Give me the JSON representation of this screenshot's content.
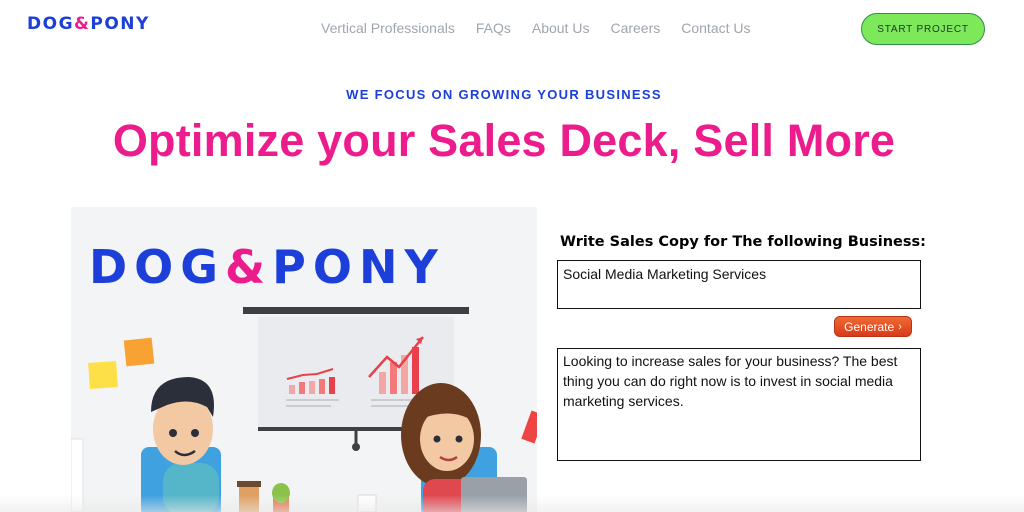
{
  "header": {
    "logo_left": "DOG",
    "logo_amp": "&",
    "logo_right": "PONY",
    "nav": [
      "Vertical Professionals",
      "FAQs",
      "About Us",
      "Careers",
      "Contact Us"
    ],
    "cta_label": "START PROJECT"
  },
  "hero": {
    "eyebrow": "WE FOCUS ON GROWING YOUR BUSINESS",
    "headline": "Optimize your Sales Deck, Sell More"
  },
  "illustration": {
    "logo_left": "DOG",
    "logo_amp": "&",
    "logo_right": "PONY"
  },
  "form": {
    "heading": "Write Sales Copy for The following Business:",
    "business_value": "Social Media Marketing Services",
    "generate_label": "Generate",
    "generate_icon": "chevron-right-icon",
    "output_text": "Looking to increase sales for your business? The best thing you can do right now is to invest in social media marketing services."
  },
  "colors": {
    "brand_blue": "#1b3fd8",
    "brand_pink": "#ec1c8c",
    "cta_green": "#7ce85a",
    "generate_orange": "#e8502a"
  }
}
